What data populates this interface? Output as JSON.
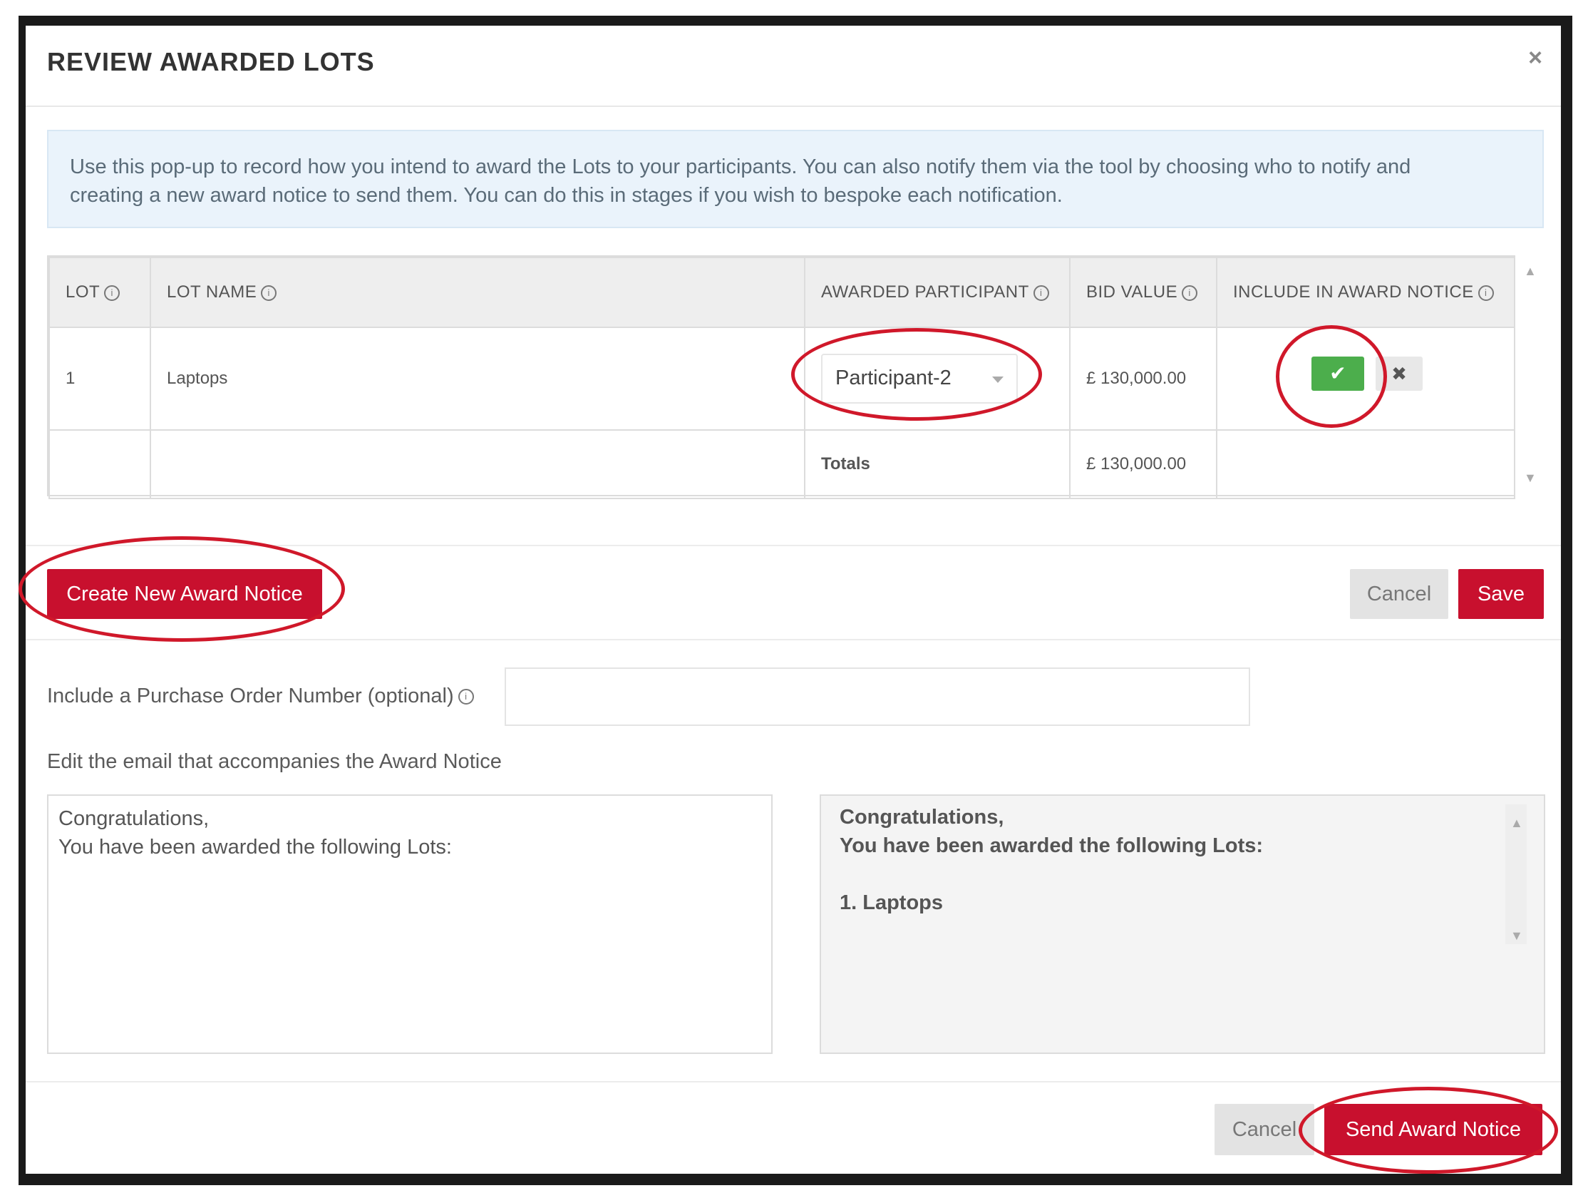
{
  "modal": {
    "title": "REVIEW AWARDED LOTS",
    "close_label": "×"
  },
  "info_text_line1": "Use this pop-up to record how you intend to award the Lots to your participants. You can also notify them via the tool by choosing who to notify and",
  "info_text_line2": "creating a new award notice to send them. You can do this in stages if you wish to bespoke each notification.",
  "table": {
    "headers": {
      "lot": "LOT",
      "lot_name": "LOT NAME",
      "awarded_participant": "AWARDED PARTICIPANT",
      "bid_value": "BID VALUE",
      "include_in_award_notice": "INCLUDE IN AWARD NOTICE"
    },
    "rows": [
      {
        "lot": "1",
        "lot_name": "Laptops",
        "awarded_participant": "Participant-2",
        "bid_value": "£ 130,000.00",
        "include": true
      }
    ],
    "totals_label": "Totals",
    "totals_value": "£ 130,000.00"
  },
  "icons": {
    "info": "ⓘ",
    "check": "✔",
    "x": "✖",
    "scroll_up": "▲",
    "scroll_down": "▼"
  },
  "actions": {
    "create_new_award_notice": "Create New Award Notice",
    "cancel": "Cancel",
    "save": "Save"
  },
  "po_label": "Include a Purchase Order Number (optional)",
  "po_value": "",
  "email_label": "Edit the email that accompanies the Award Notice",
  "email_editor": {
    "line1": "Congratulations,",
    "line2": "You have been awarded the following Lots:"
  },
  "email_preview": {
    "line1": "Congratulations,",
    "line2": "You have been awarded the following Lots:",
    "item1": "1. Laptops"
  },
  "footer": {
    "cancel": "Cancel",
    "send_award_notice": "Send Award Notice"
  },
  "colors": {
    "primary_red": "#c8102e",
    "success_green": "#4cae4c",
    "annotation_red": "#d0182a"
  }
}
